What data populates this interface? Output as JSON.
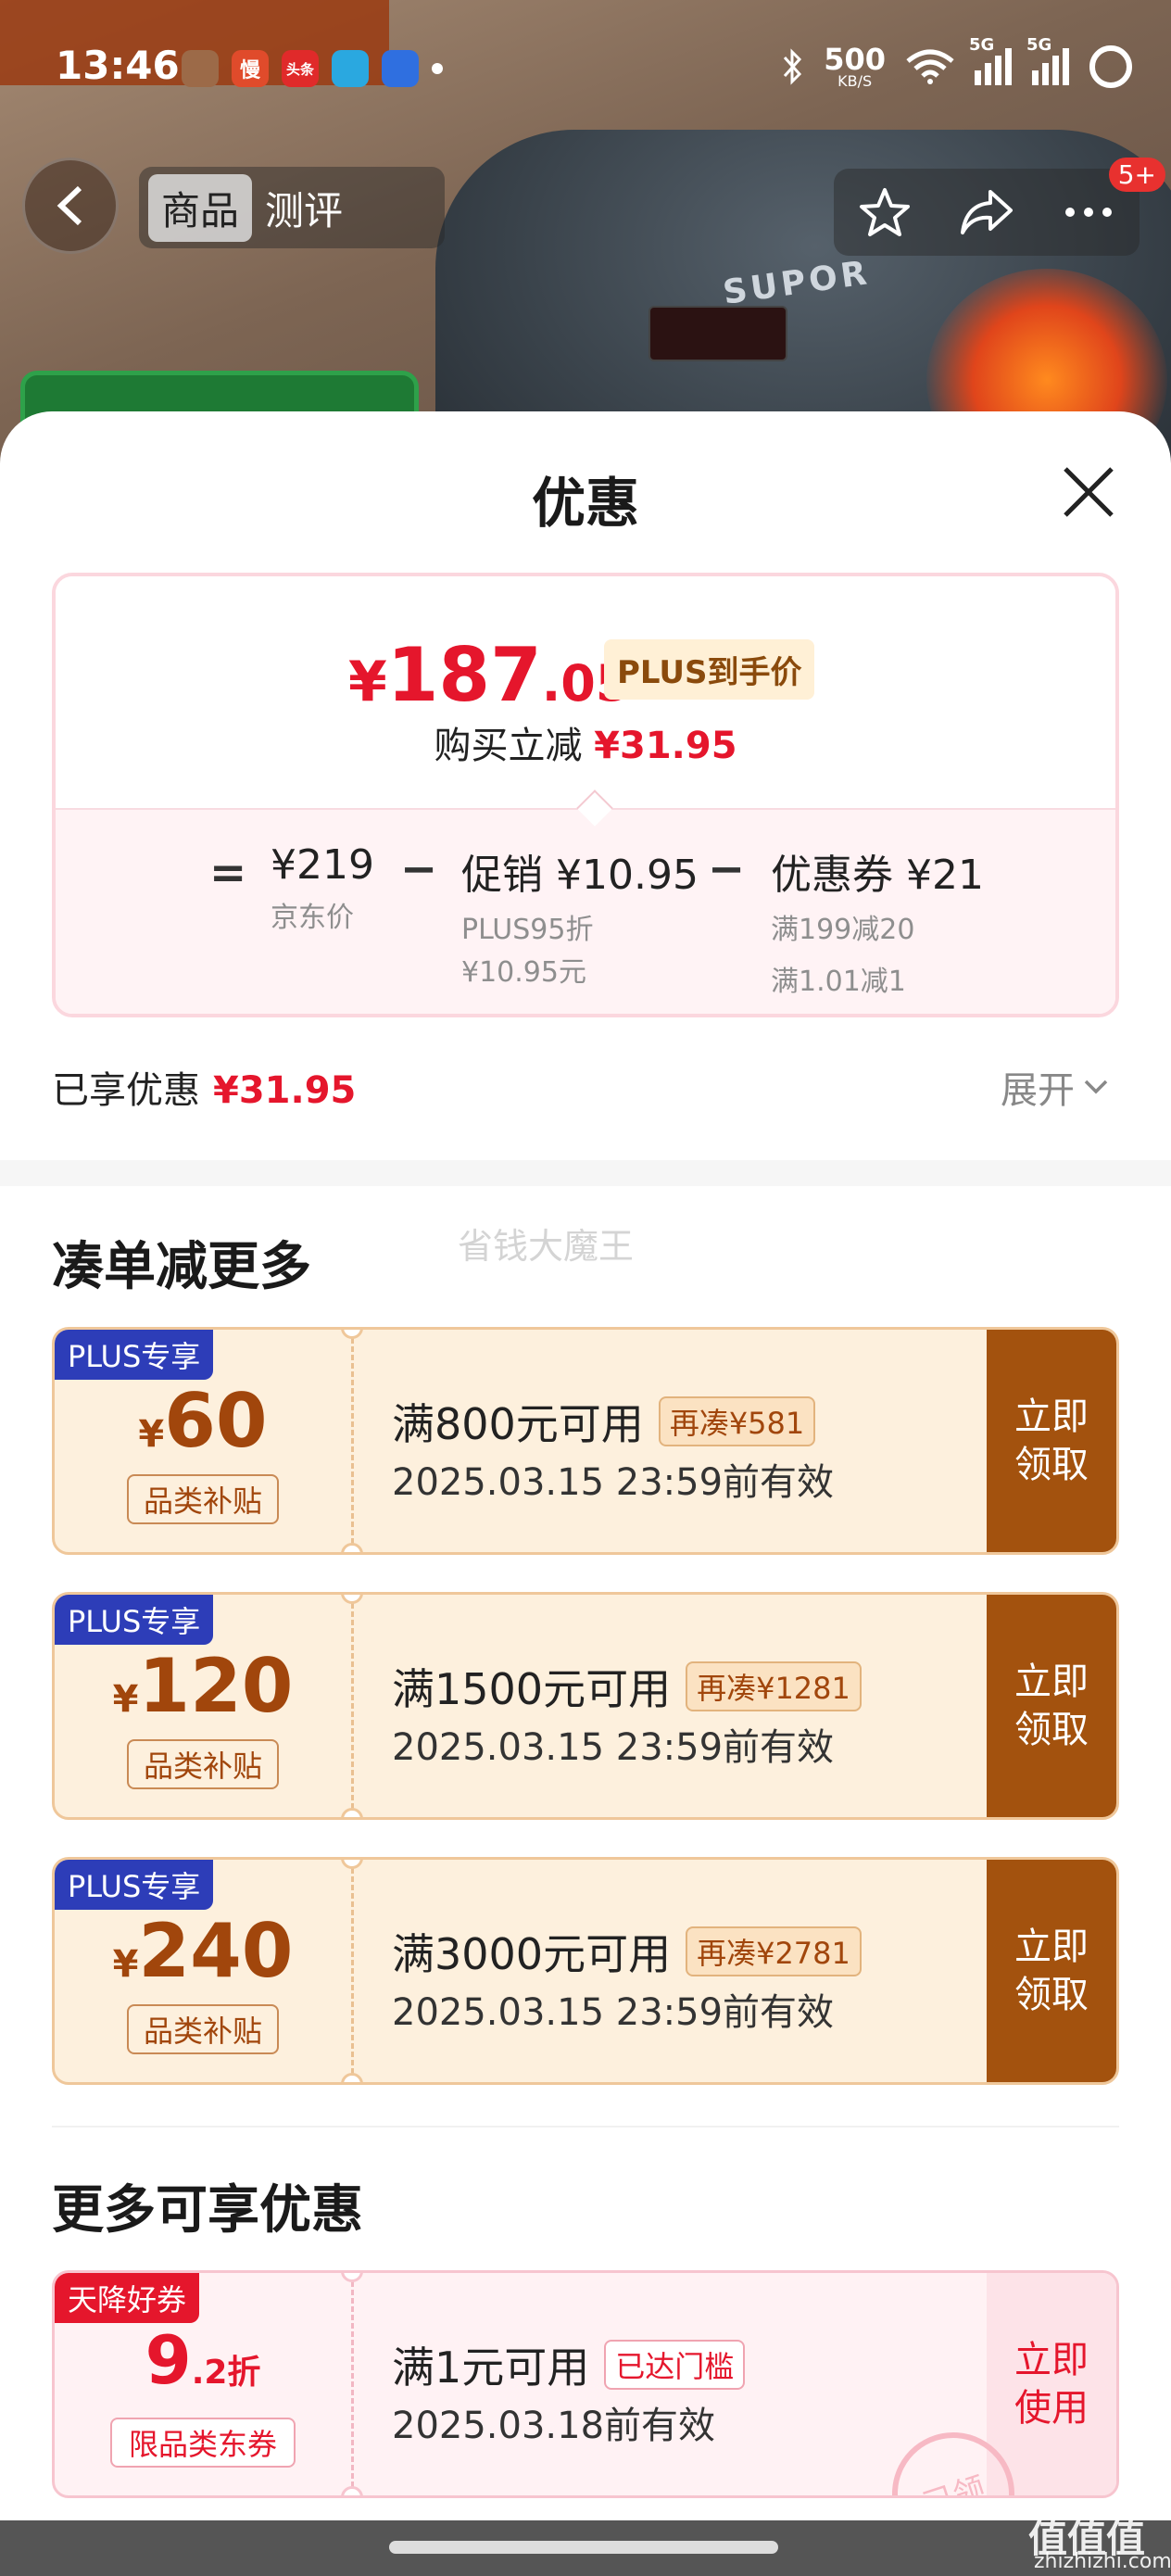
{
  "status_bar": {
    "time": "13:46",
    "net_speed": "500",
    "net_unit": "KB/S",
    "sim1": "5G",
    "sim2": "5G",
    "apps": [
      {
        "icon": "wechat-icon",
        "glyph": "",
        "color": "#9c6a48"
      },
      {
        "icon": "manqian-app-icon",
        "glyph": "慢",
        "color": "#e04b2b"
      },
      {
        "icon": "toutiao-app-icon",
        "glyph": "头条",
        "color": "#e02a2a"
      },
      {
        "icon": "qq-icon",
        "glyph": "",
        "color": "#2aa8e0"
      },
      {
        "icon": "app-icon",
        "glyph": "",
        "color": "#2f6fe0"
      }
    ]
  },
  "top_nav": {
    "tabs": [
      "商品",
      "测评"
    ],
    "active_tab": "商品",
    "message_badge": "5+"
  },
  "sheet": {
    "title": "优惠",
    "price": {
      "currency": "¥",
      "integer": "187",
      "decimal": ".05",
      "tag": "PLUS到手价",
      "direct_cut_label": "购买立减",
      "direct_cut_value": "¥31.95"
    },
    "calc": [
      {
        "op": "=",
        "value": "¥219",
        "lines": [
          "京东价"
        ]
      },
      {
        "op": "−",
        "value": "促销 ¥10.95",
        "lines": [
          "PLUS95折",
          "¥10.95元"
        ]
      },
      {
        "op": "−",
        "value": "优惠券 ¥21",
        "lines": [
          "满199减20",
          "满1.01减1"
        ]
      }
    ],
    "saved_label": "已享优惠",
    "saved_value": "¥31.95",
    "expand_label": "展开"
  },
  "watermark": "省钱大魔王",
  "section_more": {
    "title": "凑单减更多",
    "coupons": [
      {
        "tag": "PLUS专享",
        "currency": "¥",
        "amount": "60",
        "type": "品类补贴",
        "condition": "满800元可用",
        "chip": "再凑¥581",
        "valid": "2025.03.15 23:59前有效",
        "action": "立即\n领取"
      },
      {
        "tag": "PLUS专享",
        "currency": "¥",
        "amount": "120",
        "type": "品类补贴",
        "condition": "满1500元可用",
        "chip": "再凑¥1281",
        "valid": "2025.03.15 23:59前有效",
        "action": "立即\n领取"
      },
      {
        "tag": "PLUS专享",
        "currency": "¥",
        "amount": "240",
        "type": "品类补贴",
        "condition": "满3000元可用",
        "chip": "再凑¥2781",
        "valid": "2025.03.15 23:59前有效",
        "action": "立即\n领取"
      }
    ]
  },
  "section_extra": {
    "title": "更多可享优惠",
    "coupon": {
      "tag": "天降好券",
      "amount": "9",
      "suffix": ".2折",
      "type": "限品类东券",
      "condition": "满1元可用",
      "chip": "已达门槛",
      "valid": "2025.03.18前有效",
      "action": "立即\n使用",
      "stamp": "已领"
    }
  },
  "footer": {
    "site_mark": "值值值",
    "site_url": "zhizhizhi.com"
  },
  "colors": {
    "accent_red": "#e5162c",
    "coupon_brown": "#a3520e",
    "plus_blue": "#2d3db8"
  }
}
